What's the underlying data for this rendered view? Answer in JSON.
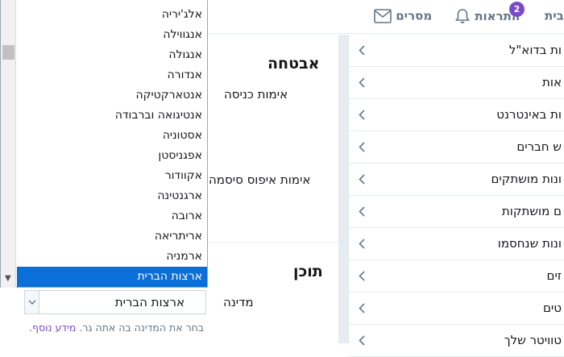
{
  "topbar": {
    "messages_label": "מסרים",
    "notifications_label": "התראות",
    "notifications_count": "2",
    "home_label": "בית"
  },
  "sidebar": {
    "items": [
      {
        "label": "ות בדוא\"ל"
      },
      {
        "label": "אות"
      },
      {
        "label": "ות באינטרנט"
      },
      {
        "label": "ש חברים"
      },
      {
        "label": "ונות מושתקים"
      },
      {
        "label": "ם מושתקות"
      },
      {
        "label": "ונות שנחסמו"
      },
      {
        "label": "זים"
      },
      {
        "label": "טים"
      },
      {
        "label": "טוויטר שלך"
      }
    ]
  },
  "main": {
    "security_title": "אבטחה",
    "login_verification": "אימות כניסה",
    "password_reset_verification": "אימות איפוס סיסמה",
    "content_title": "תוכן",
    "country_label": "מדינה",
    "country_value": "ארצות הברית",
    "help_text": "בחר את המדינה בה אתה גר.",
    "help_link": "מידע נוסף."
  },
  "dropdown": {
    "options": [
      "אלג'יריה",
      "אנגווילה",
      "אנגולה",
      "אנדורה",
      "אנטארקטיקה",
      "אנטיגואה וברבודה",
      "אסטוניה",
      "אפגניסטן",
      "אקוודור",
      "ארגנטינה",
      "ארובה",
      "אריתריאה",
      "ארמניה",
      "ארצות הברית"
    ],
    "selected": "ארצות הברית"
  },
  "colors": {
    "accent": "#794bc4",
    "selection": "#0a6fd8",
    "text": "#14171a",
    "muted": "#657786"
  }
}
